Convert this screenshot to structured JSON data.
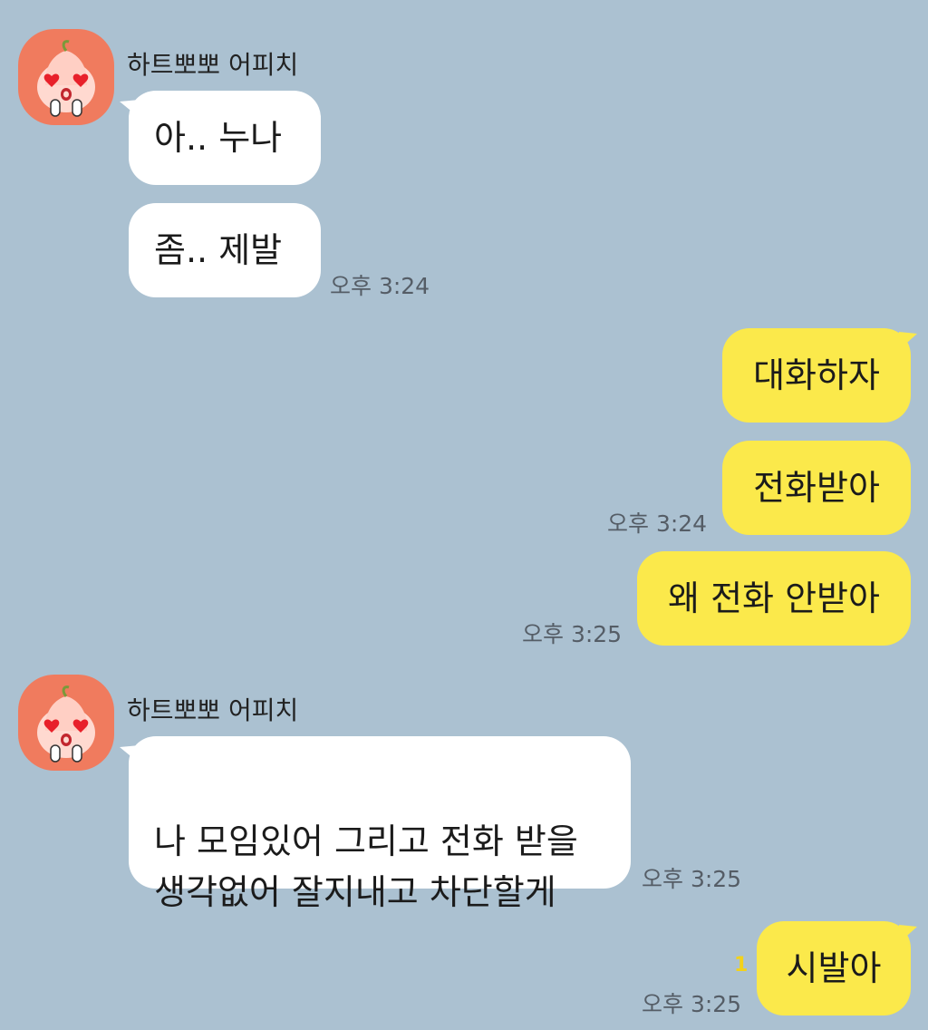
{
  "groups": [
    {
      "sender": "하트뽀뽀 어피치",
      "messages": [
        "아.. 누나",
        "좀..  제발"
      ],
      "time": "오후 3:24"
    },
    {
      "sender": "하트뽀뽀 어피치",
      "messages": [
        "나 모임있어 그리고 전화 받을\n생각없어 잘지내고 차단할게"
      ],
      "time": "오후 3:25"
    }
  ],
  "outgoing": [
    {
      "text": "대화하자"
    },
    {
      "text": "전화받아",
      "time": "오후 3:24"
    },
    {
      "text": "왜 전화 안받아",
      "time": "오후 3:25"
    },
    {
      "text": "시발아",
      "time": "오후 3:25",
      "unread": "1"
    }
  ],
  "colors": {
    "background": "#abc1d1",
    "incoming_bubble": "#ffffff",
    "outgoing_bubble": "#fbe94b",
    "avatar_bg": "#f07b5e",
    "unread_count": "#f3d21a"
  },
  "icons": [
    "apeach-heart-eyes-avatar"
  ]
}
